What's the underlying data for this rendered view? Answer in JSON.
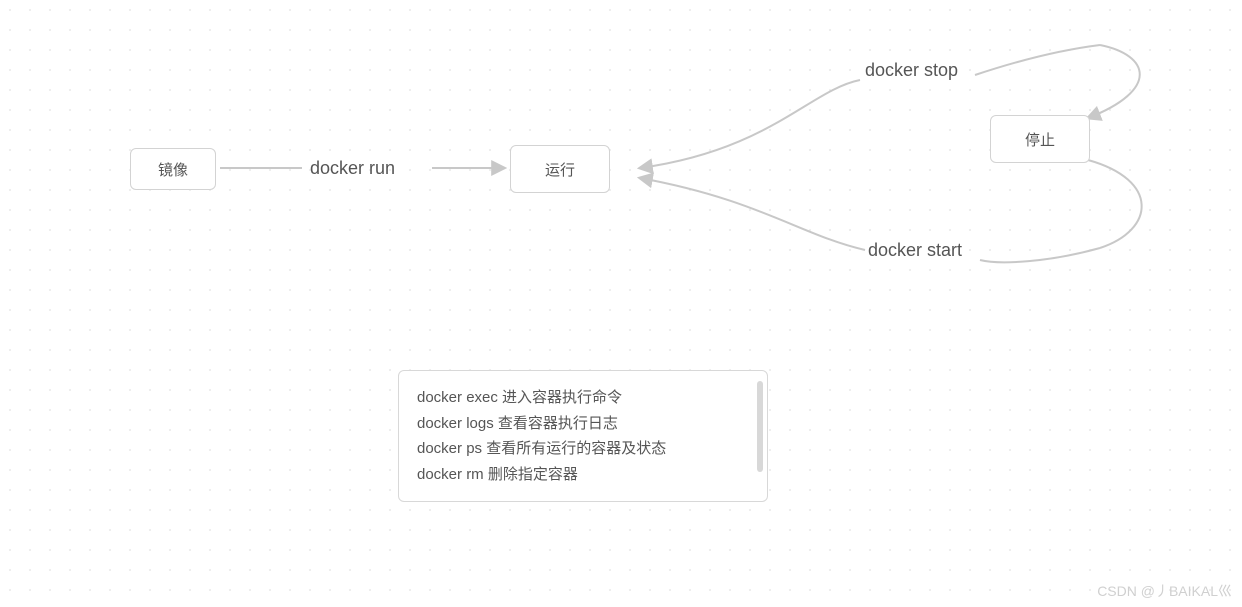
{
  "nodes": {
    "image": {
      "label": "镜像"
    },
    "running": {
      "label": "运行"
    },
    "stopped": {
      "label": "停止"
    }
  },
  "edges": {
    "run": {
      "label": "docker run"
    },
    "stop": {
      "label": "docker stop"
    },
    "start": {
      "label": "docker start"
    }
  },
  "info": {
    "lines": [
      "docker exec 进入容器执行命令",
      "docker logs 查看容器执行日志",
      "docker ps 查看所有运行的容器及状态",
      "docker rm 删除指定容器"
    ]
  },
  "watermark": "CSDN @丿BAIKAL巛",
  "colors": {
    "node_border": "#d3d3d3",
    "text": "#555555",
    "arrow": "#c8c8c8",
    "dot": "#e8e8e8"
  }
}
